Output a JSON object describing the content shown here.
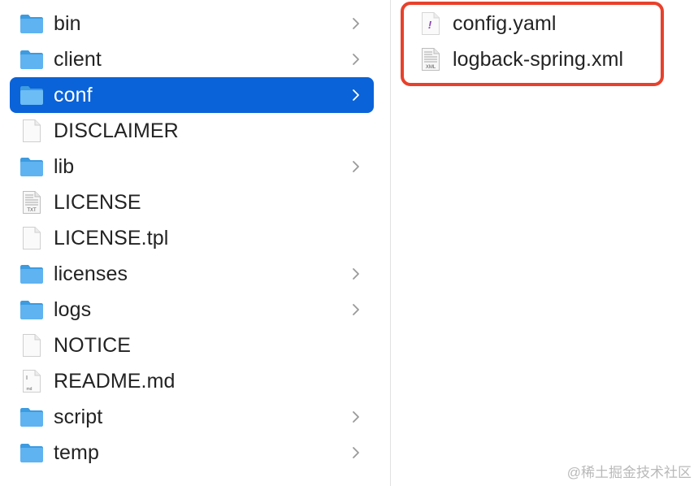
{
  "left_column": {
    "items": [
      {
        "label": "bin",
        "icon": "folder-icon",
        "has_chevron": true
      },
      {
        "label": "client",
        "icon": "folder-icon",
        "has_chevron": true
      },
      {
        "label": "conf",
        "icon": "folder-icon",
        "has_chevron": true,
        "selected": true
      },
      {
        "label": "DISCLAIMER",
        "icon": "document-icon",
        "has_chevron": false
      },
      {
        "label": "lib",
        "icon": "folder-icon",
        "has_chevron": true
      },
      {
        "label": "LICENSE",
        "icon": "txt-file-icon",
        "has_chevron": false
      },
      {
        "label": "LICENSE.tpl",
        "icon": "document-icon",
        "has_chevron": false
      },
      {
        "label": "licenses",
        "icon": "folder-icon",
        "has_chevron": true
      },
      {
        "label": "logs",
        "icon": "folder-icon",
        "has_chevron": true
      },
      {
        "label": "NOTICE",
        "icon": "document-icon",
        "has_chevron": false
      },
      {
        "label": "README.md",
        "icon": "markdown-file-icon",
        "has_chevron": false
      },
      {
        "label": "script",
        "icon": "folder-icon",
        "has_chevron": true
      },
      {
        "label": "temp",
        "icon": "folder-icon",
        "has_chevron": true
      }
    ]
  },
  "right_column": {
    "items": [
      {
        "label": "config.yaml",
        "icon": "yaml-file-icon"
      },
      {
        "label": "logback-spring.xml",
        "icon": "xml-file-icon"
      }
    ]
  },
  "icon_text": {
    "txt": "TXT",
    "xml": "XML",
    "md": "md",
    "yaml": "!"
  },
  "watermark": "@稀土掘金技术社区",
  "colors": {
    "selection": "#0a63d8",
    "highlight_border": "#e8412b",
    "folder_body": "#5fb3f1",
    "folder_tab": "#3d9be0",
    "chevron": "#9a9a9a",
    "text": "#232323"
  }
}
